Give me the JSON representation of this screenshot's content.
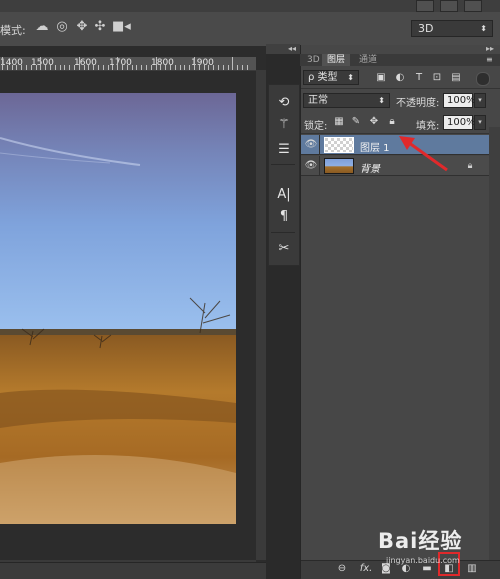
{
  "options_bar": {
    "mode_label": "模式:",
    "icons": [
      "orbit-3d-icon",
      "roll-3d-icon",
      "pan-3d-icon",
      "slide-3d-icon",
      "camera-3d-icon"
    ],
    "workspace_value": "3D"
  },
  "ruler": {
    "labels": [
      "1400",
      "1500",
      "1600",
      "1700",
      "1800",
      "1900"
    ]
  },
  "tools": [
    "history-brush-icon",
    "brush-presets-icon",
    "adjustments-icon",
    "character-icon",
    "paragraph-icon",
    "tool-presets-icon"
  ],
  "panel": {
    "tabs": [
      "3D",
      "图层",
      "通道"
    ],
    "active_tab": "图层",
    "filter_type": "ρ 类型",
    "filter_icons": [
      "image-filter-icon",
      "adjustment-filter-icon",
      "type-filter-icon",
      "shape-filter-icon",
      "smart-object-filter-icon"
    ],
    "blend_mode": "正常",
    "opacity_label": "不透明度:",
    "opacity_value": "100%",
    "lock_label": "锁定:",
    "fill_label": "填充:",
    "fill_value": "100%",
    "layers": [
      {
        "name": "图层 1",
        "selected": true,
        "locked": false
      },
      {
        "name": "背景",
        "selected": false,
        "locked": true
      }
    ],
    "bottom_icons": [
      "link-icon",
      "fx-icon",
      "mask-icon",
      "adjustment-layer-icon",
      "group-icon",
      "new-layer-icon",
      "trash-icon"
    ],
    "bottom_fx_label": "fx."
  },
  "annotation_color": "#e0292b",
  "watermark": {
    "text": "Bai经验",
    "sub": "jingyan.baidu.com"
  }
}
